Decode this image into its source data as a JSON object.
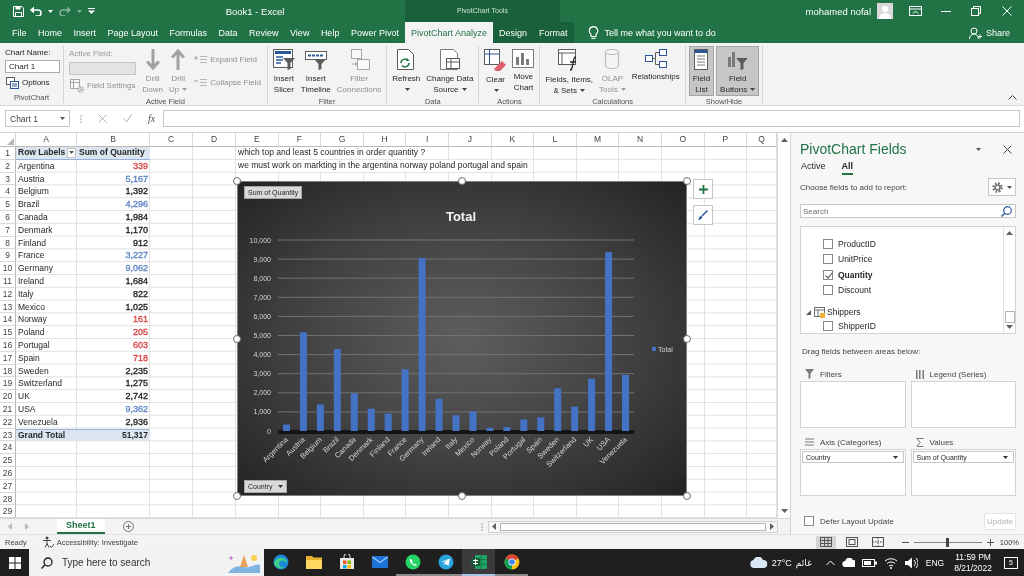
{
  "title_bar": {
    "quick_access": [
      {
        "disabled": false
      },
      {
        "disabled": false
      },
      {
        "disabled": true
      },
      {
        "disabled": false
      }
    ],
    "title": "Book1 - Excel",
    "context_group": "PivotChart Tools",
    "user": "mohamed nofal"
  },
  "ribbon_tabs": [
    {
      "label": "File",
      "selected": false
    },
    {
      "label": "Home",
      "selected": false
    },
    {
      "label": "Insert",
      "selected": false
    },
    {
      "label": "Page Layout",
      "selected": false
    },
    {
      "label": "Formulas",
      "selected": false
    },
    {
      "label": "Data",
      "selected": false
    },
    {
      "label": "Review",
      "selected": false
    },
    {
      "label": "View",
      "selected": false
    },
    {
      "label": "Help",
      "selected": false
    },
    {
      "label": "Power Pivot",
      "selected": false
    }
  ],
  "context_tabs": [
    {
      "label": "PivotChart Analyze",
      "selected": true
    },
    {
      "label": "Design",
      "selected": false
    },
    {
      "label": "Format",
      "selected": false
    }
  ],
  "tell_me": {
    "placeholder": "Tell me what you want to do"
  },
  "share": "Share",
  "ribbon_groups": [
    {
      "label": "PivotChart",
      "columns": [
        [
          {
            "kind": "label",
            "label": "Chart Name:",
            "disabled": false
          },
          {
            "kind": "field",
            "value": "Chart 1",
            "disabled": false
          },
          {
            "kind": "small",
            "lines": [
              "Options"
            ],
            "disabled": false,
            "pressed": false,
            "dropdown": false
          }
        ]
      ]
    },
    {
      "label": "Active Field",
      "columns": [
        [
          {
            "kind": "label",
            "label": "Active Field:",
            "disabled": true
          },
          {
            "kind": "field",
            "disabled": true
          },
          {
            "kind": "small",
            "lines": [
              "Field Settings"
            ],
            "disabled": true,
            "pressed": false,
            "dropdown": false
          }
        ],
        [
          {
            "kind": "large",
            "lines": [
              "Drill",
              "Down"
            ],
            "disabled": true,
            "pressed": false,
            "dropdown": false
          }
        ],
        [
          {
            "kind": "large",
            "lines": [
              "Drill",
              "Up"
            ],
            "disabled": true,
            "pressed": false,
            "dropdown": true
          }
        ],
        [
          {
            "kind": "small",
            "lines": [
              "Expand Field"
            ],
            "disabled": true,
            "pressed": false,
            "dropdown": false
          },
          {
            "kind": "small",
            "lines": [
              "Collapse Field"
            ],
            "disabled": true,
            "pressed": false,
            "dropdown": false
          }
        ]
      ]
    },
    {
      "label": "Filter",
      "columns": [
        [
          {
            "kind": "large",
            "lines": [
              "Insert",
              "Slicer"
            ],
            "disabled": false,
            "pressed": false,
            "dropdown": false
          }
        ],
        [
          {
            "kind": "large",
            "lines": [
              "Insert",
              "Timeline"
            ],
            "disabled": false,
            "pressed": false,
            "dropdown": false
          }
        ],
        [
          {
            "kind": "large",
            "lines": [
              "Filter",
              "Connections"
            ],
            "disabled": true,
            "pressed": false,
            "dropdown": false
          }
        ]
      ]
    },
    {
      "label": "Data",
      "columns": [
        [
          {
            "kind": "large",
            "lines": [
              "Refresh"
            ],
            "disabled": false,
            "pressed": false,
            "dropdown": true
          }
        ],
        [
          {
            "kind": "large",
            "lines": [
              "Change Data",
              "Source"
            ],
            "disabled": false,
            "pressed": false,
            "dropdown": true
          }
        ]
      ]
    },
    {
      "label": "Actions",
      "columns": [
        [
          {
            "kind": "large",
            "lines": [
              "Clear"
            ],
            "disabled": false,
            "pressed": false,
            "dropdown": true
          }
        ],
        [
          {
            "kind": "large",
            "lines": [
              "Move",
              "Chart"
            ],
            "disabled": false,
            "pressed": false,
            "dropdown": false
          }
        ]
      ]
    },
    {
      "label": "Calculations",
      "columns": [
        [
          {
            "kind": "large",
            "lines": [
              "Fields, Items,",
              "& Sets"
            ],
            "disabled": false,
            "pressed": false,
            "dropdown": true
          }
        ],
        [
          {
            "kind": "large",
            "lines": [
              "OLAP",
              "Tools"
            ],
            "disabled": true,
            "pressed": false,
            "dropdown": true
          }
        ],
        [
          {
            "kind": "large",
            "lines": [
              "Relationships"
            ],
            "disabled": false,
            "pressed": false,
            "dropdown": false
          }
        ]
      ]
    },
    {
      "label": "Show/Hide",
      "columns": [
        [
          {
            "kind": "large",
            "lines": [
              "Field",
              "List"
            ],
            "disabled": false,
            "pressed": true,
            "dropdown": false
          }
        ],
        [
          {
            "kind": "large",
            "lines": [
              "Field",
              "Buttons"
            ],
            "disabled": false,
            "pressed": true,
            "dropdown": true
          }
        ]
      ]
    }
  ],
  "formula_bar": {
    "name_box": "Chart 1",
    "buttons": [
      {
        "disabled": true
      },
      {
        "disabled": true
      }
    ],
    "function_label": "fx"
  },
  "sheet": {
    "columns": [
      "A",
      "B",
      "C",
      "D",
      "E",
      "F",
      "G",
      "H",
      "I",
      "J",
      "K",
      "L",
      "M",
      "N",
      "O",
      "P",
      "Q"
    ],
    "row_numbers": [
      "1",
      "2",
      "3",
      "4",
      "5",
      "6",
      "7",
      "8",
      "9",
      "10",
      "11",
      "12",
      "13",
      "14",
      "15",
      "16",
      "17",
      "18",
      "19",
      "20",
      "21",
      "22",
      "23",
      "24",
      "25",
      "26",
      "27",
      "28",
      "29"
    ],
    "pivot": {
      "headers": [
        "Row Labels",
        "Sum of Quantity"
      ],
      "rows": [
        {
          "label": "Argentina",
          "value": "339",
          "color": "#d8474b"
        },
        {
          "label": "Austria",
          "value": "5,167",
          "color": "#5f86c6"
        },
        {
          "label": "Belgium",
          "value": "1,392",
          "color": "#262626"
        },
        {
          "label": "Brazil",
          "value": "4,296",
          "color": "#5f86c6"
        },
        {
          "label": "Canada",
          "value": "1,984",
          "color": "#262626"
        },
        {
          "label": "Denmark",
          "value": "1,170",
          "color": "#262626"
        },
        {
          "label": "Finland",
          "value": "912",
          "color": "#262626"
        },
        {
          "label": "France",
          "value": "3,227",
          "color": "#5f86c6"
        },
        {
          "label": "Germany",
          "value": "9,062",
          "color": "#5f86c6"
        },
        {
          "label": "Ireland",
          "value": "1,684",
          "color": "#262626"
        },
        {
          "label": "Italy",
          "value": "822",
          "color": "#262626"
        },
        {
          "label": "Mexico",
          "value": "1,025",
          "color": "#262626"
        },
        {
          "label": "Norway",
          "value": "161",
          "color": "#d8474b"
        },
        {
          "label": "Poland",
          "value": "205",
          "color": "#d8474b"
        },
        {
          "label": "Portugal",
          "value": "603",
          "color": "#d8474b"
        },
        {
          "label": "Spain",
          "value": "718",
          "color": "#d8474b"
        },
        {
          "label": "Sweden",
          "value": "2,235",
          "color": "#262626"
        },
        {
          "label": "Switzerland",
          "value": "1,275",
          "color": "#262626"
        },
        {
          "label": "UK",
          "value": "2,742",
          "color": "#262626"
        },
        {
          "label": "USA",
          "value": "9,362",
          "color": "#5f86c6"
        },
        {
          "label": "Venezuela",
          "value": "2,936",
          "color": "#262626"
        }
      ],
      "total": {
        "label": "Grand Total",
        "value": "51,317"
      }
    },
    "notes": [
      "which top and least 5 countries in order quantity ?",
      "we must work on markting in the argentina norway poland portugal and spain"
    ]
  },
  "chart": {
    "value_button": "Sum of Quantity",
    "axis_button": "Country",
    "chart_data": {
      "type": "bar",
      "title": "Total",
      "categories": [
        "Argentina",
        "Austria",
        "Belgium",
        "Brazil",
        "Canada",
        "Denmark",
        "Finland",
        "France",
        "Germany",
        "Ireland",
        "Italy",
        "Mexico",
        "Norway",
        "Poland",
        "Portugal",
        "Spain",
        "Sweden",
        "Switzerland",
        "UK",
        "USA",
        "Venezuela"
      ],
      "series": [
        {
          "name": "Total",
          "color": "#4472c4",
          "values": [
            339,
            5167,
            1392,
            4296,
            1984,
            1170,
            912,
            3227,
            9062,
            1684,
            822,
            1025,
            161,
            205,
            603,
            718,
            2235,
            1275,
            2742,
            9362,
            2936
          ]
        }
      ],
      "ylim": [
        0,
        10000
      ],
      "yticks": [
        {
          "value": 0,
          "label": "0"
        },
        {
          "value": 1000,
          "label": "1,000"
        },
        {
          "value": 2000,
          "label": "2,000"
        },
        {
          "value": 3000,
          "label": "3,000"
        },
        {
          "value": 4000,
          "label": "4,000"
        },
        {
          "value": 5000,
          "label": "5,000"
        },
        {
          "value": 6000,
          "label": "6,000"
        },
        {
          "value": 7000,
          "label": "7,000"
        },
        {
          "value": 8000,
          "label": "8,000"
        },
        {
          "value": 9000,
          "label": "9,000"
        },
        {
          "value": 10000,
          "label": "10,000"
        }
      ],
      "grid": true
    }
  },
  "field_pane": {
    "title": "PivotChart Fields",
    "tabs": [
      {
        "label": "Active",
        "selected": false
      },
      {
        "label": "All",
        "selected": true
      }
    ],
    "prompt": "Choose fields to add to report:",
    "search": {
      "placeholder": "Search"
    },
    "fields": [
      {
        "kind": "field",
        "label": "ProductID",
        "checked": false
      },
      {
        "kind": "field",
        "label": "UnitPrice",
        "checked": false
      },
      {
        "kind": "field",
        "label": "Quantity",
        "checked": true
      },
      {
        "kind": "field",
        "label": "Discount",
        "checked": false
      },
      {
        "kind": "table",
        "label": "Shippers",
        "expanded": true,
        "children": [
          {
            "kind": "field",
            "label": "ShipperID",
            "checked": false
          }
        ]
      }
    ],
    "areas_prompt": "Drag fields between areas below:",
    "areas": [
      {
        "label": "Filters"
      },
      {
        "label": "Legend (Series)"
      },
      {
        "label": "Axis (Categories)",
        "fields": [
          "Country"
        ]
      },
      {
        "label": "Values",
        "fields": [
          "Sum of Quantity"
        ]
      }
    ],
    "defer": {
      "label": "Defer Layout Update",
      "checked": false
    },
    "update_button": {
      "label": "Update",
      "disabled": true
    }
  },
  "sheet_tabs": {
    "nav": [
      {
        "disabled": true
      },
      {
        "disabled": true
      }
    ],
    "tabs": [
      {
        "label": "Sheet1",
        "selected": true
      }
    ]
  },
  "status_bar": {
    "mode": "Ready",
    "accessibility": "Accessibility: Investigate",
    "views": [
      {
        "selected": true
      },
      {
        "selected": false
      },
      {
        "selected": false
      }
    ],
    "zoom": {
      "level": 0.5
    },
    "zoom_label": "100%"
  },
  "taskbar": {
    "search": {
      "placeholder": "Type here to search"
    },
    "apps": [
      {
        "running": false,
        "active": false
      },
      {
        "running": false,
        "active": false
      },
      {
        "running": false,
        "active": false
      },
      {
        "running": false,
        "active": false
      },
      {
        "running": true,
        "active": false
      },
      {
        "running": true,
        "active": false
      },
      {
        "running": true,
        "active": true
      },
      {
        "running": true,
        "active": false
      }
    ],
    "weather": {
      "temperature": "27°C",
      "condition": "غائم"
    },
    "language": "ENG",
    "time": "11:59 PM",
    "date": "8/21/2022",
    "notifications": "5"
  }
}
